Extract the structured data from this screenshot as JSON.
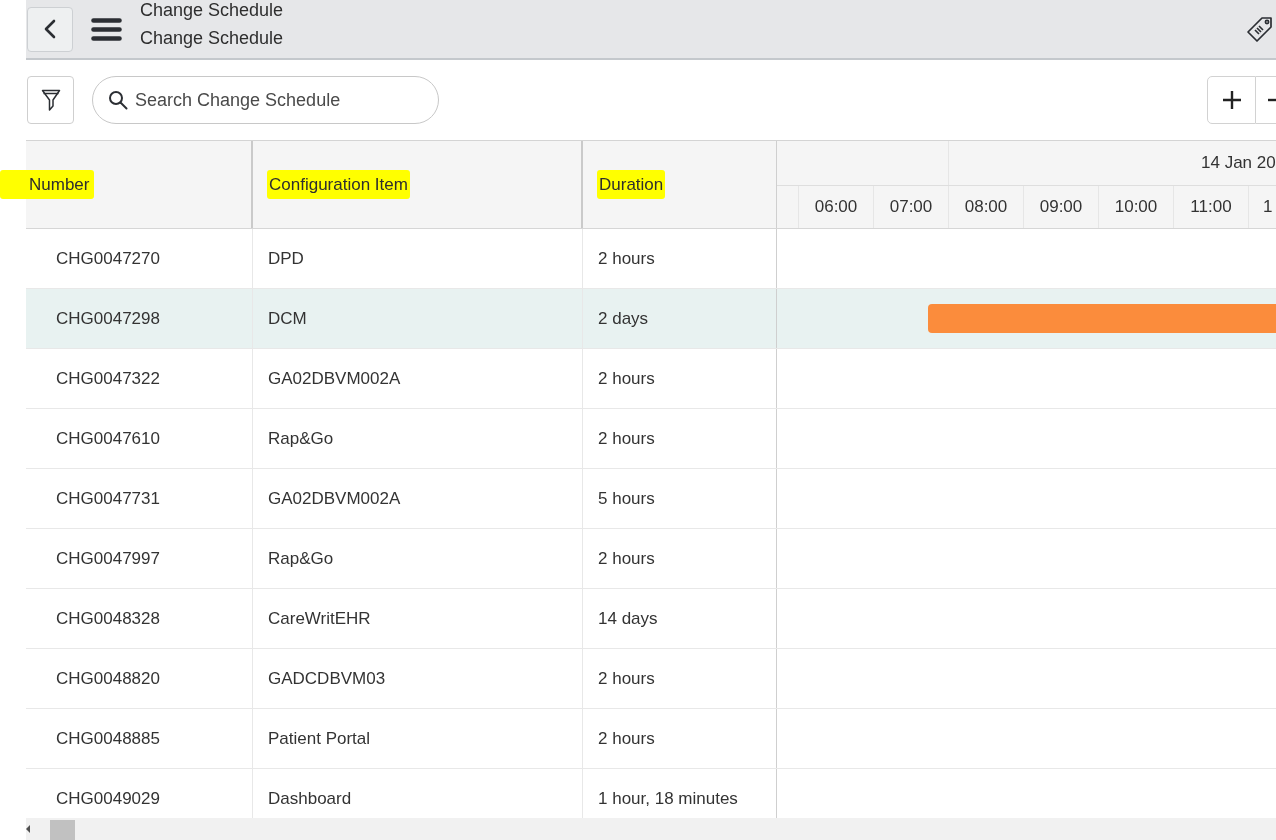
{
  "header": {
    "titles": [
      "Change Schedule",
      "Change Schedule"
    ]
  },
  "search": {
    "placeholder": "Search Change Schedule"
  },
  "table": {
    "columns": [
      {
        "label": "Number",
        "highlighted": true
      },
      {
        "label": "Configuration Item",
        "highlighted": true
      },
      {
        "label": "Duration",
        "highlighted": true
      }
    ],
    "timeline": {
      "date": "14 Jan 20",
      "hours": [
        "06:00",
        "07:00",
        "08:00",
        "09:00",
        "10:00",
        "11:00",
        "1"
      ]
    },
    "rows": [
      {
        "number": "CHG0047270",
        "configuration_item": "DPD",
        "duration": "2 hours",
        "selected": false,
        "bar_shown": false
      },
      {
        "number": "CHG0047298",
        "configuration_item": "DCM",
        "duration": "2 days",
        "selected": true,
        "bar_shown": true
      },
      {
        "number": "CHG0047322",
        "configuration_item": "GA02DBVM002A",
        "duration": "2 hours",
        "selected": false,
        "bar_shown": false
      },
      {
        "number": "CHG0047610",
        "configuration_item": "Rap&Go",
        "duration": "2 hours",
        "selected": false,
        "bar_shown": false
      },
      {
        "number": "CHG0047731",
        "configuration_item": "GA02DBVM002A",
        "duration": "5 hours",
        "selected": false,
        "bar_shown": false
      },
      {
        "number": "CHG0047997",
        "configuration_item": "Rap&Go",
        "duration": "2 hours",
        "selected": false,
        "bar_shown": false
      },
      {
        "number": "CHG0048328",
        "configuration_item": "CareWritEHR",
        "duration": "14 days",
        "selected": false,
        "bar_shown": false
      },
      {
        "number": "CHG0048820",
        "configuration_item": "GADCDBVM03",
        "duration": "2 hours",
        "selected": false,
        "bar_shown": false
      },
      {
        "number": "CHG0048885",
        "configuration_item": "Patient Portal",
        "duration": "2 hours",
        "selected": false,
        "bar_shown": false
      },
      {
        "number": "CHG0049029",
        "configuration_item": "Dashboard",
        "duration": "1 hour, 18 minutes",
        "selected": false,
        "bar_shown": false
      }
    ]
  }
}
